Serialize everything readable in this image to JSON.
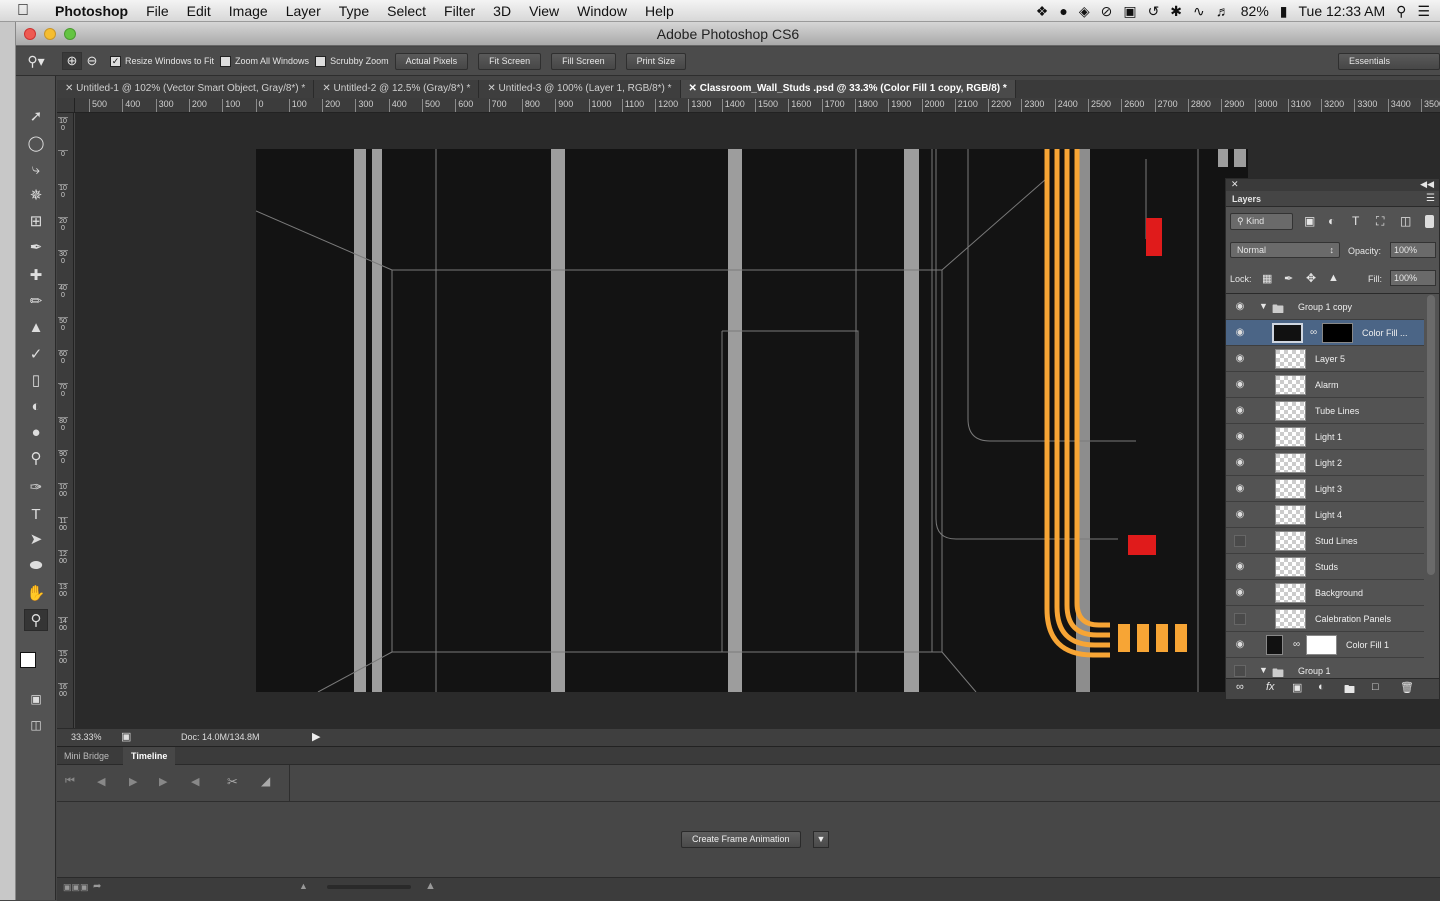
{
  "menubar": {
    "app": "Photoshop",
    "items": [
      "File",
      "Edit",
      "Image",
      "Layer",
      "Type",
      "Select",
      "Filter",
      "3D",
      "View",
      "Window",
      "Help"
    ],
    "battery": "82%",
    "clock": "Tue 12:33 AM"
  },
  "window": {
    "title": "Adobe Photoshop CS6"
  },
  "options": {
    "resize_windows": "Resize Windows to Fit",
    "zoom_all": "Zoom All Windows",
    "scrubby": "Scrubby Zoom",
    "actual_pixels": "Actual Pixels",
    "fit_screen": "Fit Screen",
    "fill_screen": "Fill Screen",
    "print_size": "Print Size",
    "workspace": "Essentials"
  },
  "tabs": [
    {
      "label": "Untitled-1 @ 102% (Vector Smart Object, Gray/8*) *"
    },
    {
      "label": "Untitled-2 @ 12.5% (Gray/8*) *"
    },
    {
      "label": "Untitled-3 @ 100% (Layer 1, RGB/8*) *"
    },
    {
      "label": "Classroom_Wall_Studs .psd @ 33.3% (Color Fill 1 copy, RGB/8) *"
    }
  ],
  "ruler_h": [
    "500",
    "400",
    "300",
    "200",
    "100",
    "0",
    "100",
    "200",
    "300",
    "400",
    "500",
    "600",
    "700",
    "800",
    "900",
    "1000",
    "1100",
    "1200",
    "1300",
    "1400",
    "1500",
    "1600",
    "1700",
    "1800",
    "1900",
    "2000",
    "2100",
    "2200",
    "2300",
    "2400",
    "2500",
    "2600",
    "2700",
    "2800",
    "2900",
    "3000",
    "3100",
    "3200",
    "3300",
    "3400",
    "3500"
  ],
  "ruler_v": [
    "100",
    "0",
    "100",
    "200",
    "300",
    "400",
    "500",
    "600",
    "700",
    "800",
    "900",
    "1000",
    "1100",
    "1200",
    "1300",
    "1400",
    "1500",
    "1600"
  ],
  "status": {
    "zoom": "33.33%",
    "doc": "Doc: 14.0M/134.8M"
  },
  "bottom": {
    "tabs": [
      "Mini Bridge",
      "Timeline"
    ],
    "create_button": "Create Frame Animation"
  },
  "layers_panel": {
    "title": "Layers",
    "kind": "Kind",
    "blend": "Normal",
    "opacity_label": "Opacity:",
    "opacity": "100%",
    "lock_label": "Lock:",
    "fill_label": "Fill:",
    "fill": "100%",
    "layers": [
      {
        "name": "Group 1 copy",
        "visible": true
      },
      {
        "name": "Color Fill ...",
        "visible": true
      },
      {
        "name": "Layer 5",
        "visible": true
      },
      {
        "name": "Alarm",
        "visible": true
      },
      {
        "name": "Tube Lines",
        "visible": true
      },
      {
        "name": "Light 1",
        "visible": true
      },
      {
        "name": "Light 2",
        "visible": true
      },
      {
        "name": "Light 3",
        "visible": true
      },
      {
        "name": "Light 4",
        "visible": true
      },
      {
        "name": "Stud Lines",
        "visible": false
      },
      {
        "name": "Studs",
        "visible": true
      },
      {
        "name": "Background",
        "visible": true
      },
      {
        "name": "Calebration Panels",
        "visible": false
      },
      {
        "name": "Color Fill 1",
        "visible": true
      },
      {
        "name": "Group 1",
        "visible": false
      }
    ]
  },
  "colors": {
    "accent_orange": "#f7a535",
    "alarm_red": "#e01b1b",
    "selection": "#4b6586"
  }
}
